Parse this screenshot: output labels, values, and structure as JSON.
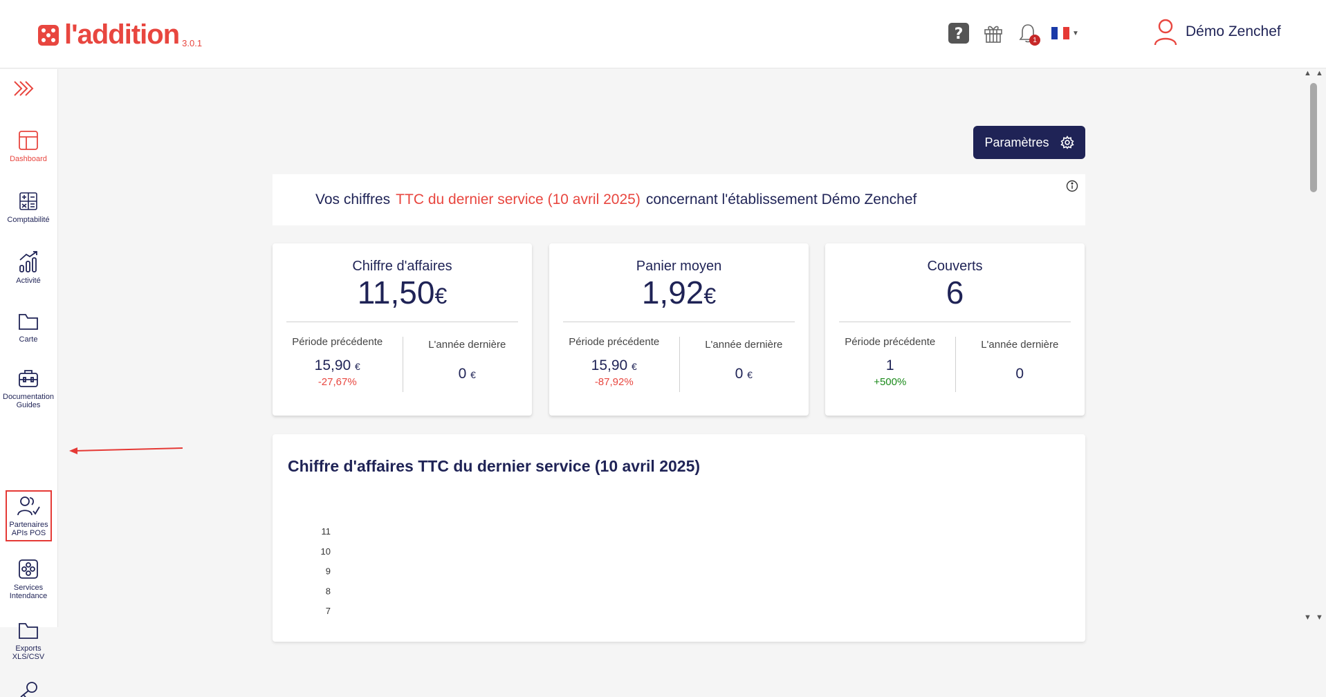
{
  "header": {
    "logo_text": "l'addition",
    "version": "3.0.1",
    "notification_count": "1",
    "user_name": "Démo Zenchef"
  },
  "sidebar": {
    "items": [
      {
        "label": "Dashboard",
        "icon": "dashboard-icon"
      },
      {
        "label": "Comptabilité",
        "icon": "calculator-icon"
      },
      {
        "label": "Activité",
        "icon": "bar-chart-icon"
      },
      {
        "label": "Carte",
        "icon": "folder-icon"
      },
      {
        "label": "Documentation\nGuides",
        "icon": "briefcase-icon"
      },
      {
        "label": "Partenaires\nAPIs POS",
        "icon": "partners-icon"
      },
      {
        "label": "Services\nIntendance",
        "icon": "services-icon"
      },
      {
        "label": "Exports\nXLS/CSV",
        "icon": "folder-icon"
      }
    ]
  },
  "main": {
    "params_label": "Paramètres",
    "banner": {
      "prefix": "Vos chiffres",
      "highlight": "TTC du dernier service (10 avril 2025)",
      "suffix": "concernant l'établissement Démo Zenchef"
    },
    "kpis": [
      {
        "title": "Chiffre d'affaires",
        "value": "11,50",
        "currency": "€",
        "prev_label": "Période précédente",
        "prev_value": "15,90",
        "prev_currency": "€",
        "prev_pct": "-27,67%",
        "trend": "neg",
        "last_year_label": "L'année dernière",
        "last_year_value": "0",
        "last_year_currency": "€"
      },
      {
        "title": "Panier moyen",
        "value": "1,92",
        "currency": "€",
        "prev_label": "Période précédente",
        "prev_value": "15,90",
        "prev_currency": "€",
        "prev_pct": "-87,92%",
        "trend": "neg",
        "last_year_label": "L'année dernière",
        "last_year_value": "0",
        "last_year_currency": "€"
      },
      {
        "title": "Couverts",
        "value": "6",
        "currency": "",
        "prev_label": "Période précédente",
        "prev_value": "1",
        "prev_currency": "",
        "prev_pct": "+500%",
        "trend": "pos",
        "last_year_label": "L'année dernière",
        "last_year_value": "0",
        "last_year_currency": ""
      }
    ],
    "chart_title": "Chiffre d'affaires TTC du dernier service (10 avril 2025)"
  },
  "chart_data": {
    "type": "bar",
    "title": "Chiffre d'affaires TTC du dernier service (10 avril 2025)",
    "y_ticks": [
      11,
      10,
      9,
      8,
      7
    ],
    "categories": [],
    "values": []
  },
  "colors": {
    "brand": "#e8463f",
    "navy": "#1f2356",
    "positive": "#1a8a1a"
  }
}
